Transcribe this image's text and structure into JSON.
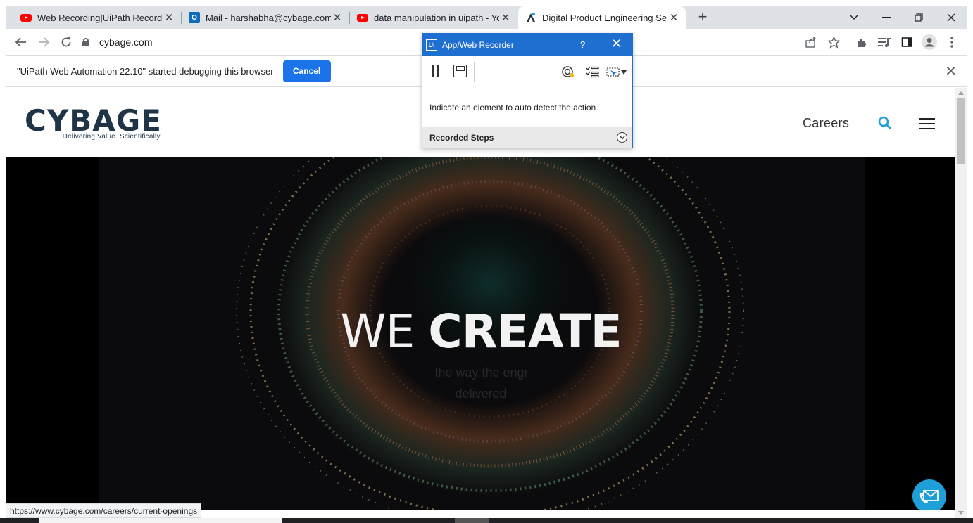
{
  "browser": {
    "tabs": [
      {
        "title": "Web Recording|UiPath Recording",
        "icon": "youtube-icon"
      },
      {
        "title": "Mail - harshabha@cybage.com",
        "icon": "outlook-icon"
      },
      {
        "title": "data manipulation in uipath - You",
        "icon": "youtube-icon"
      },
      {
        "title": "Digital Product Engineering Servi",
        "icon": "cybage-icon",
        "active": true
      }
    ],
    "url": "cybage.com",
    "status_url": "https://www.cybage.com/careers/current-openings"
  },
  "infobar": {
    "message": "\"UiPath Web Automation 22.10\" started debugging this browser",
    "cancel_label": "Cancel"
  },
  "recorder": {
    "title": "App/Web Recorder",
    "logo": "Ui",
    "help": "?",
    "instruction": "Indicate an element to auto detect the action",
    "recorded_steps_label": "Recorded Steps"
  },
  "site": {
    "logo_word": "CYBAGE",
    "logo_tagline": "Delivering Value. Scientifically.",
    "nav_careers": "Careers",
    "hero_light": "WE ",
    "hero_bold": "CREATE",
    "hero_sub_line1": "the way the engi",
    "hero_sub_line2": "delivered"
  },
  "colors": {
    "brand_navy": "#1f3447",
    "brand_accent": "#1e9fd8",
    "recorder_blue": "#1f6fd1",
    "chrome_blue": "#1a73e8"
  }
}
